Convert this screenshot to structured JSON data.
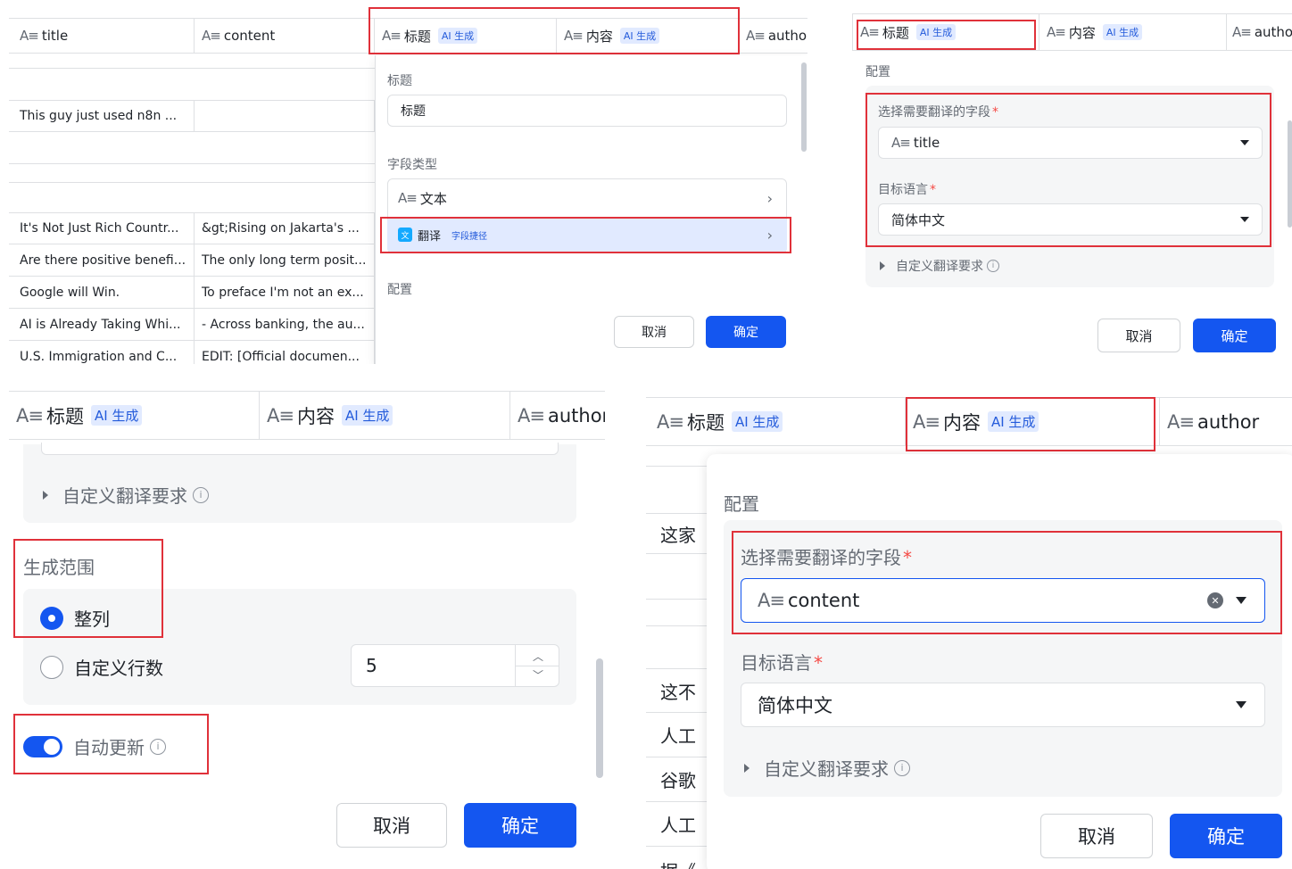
{
  "columns": {
    "title": "title",
    "content": "content",
    "title_zh": "标题",
    "content_zh": "内容",
    "author": "author",
    "author_cut": "autho",
    "ai_badge": "AI 生成"
  },
  "p1": {
    "rows": [
      {
        "title": "",
        "content": ""
      },
      {
        "title": "This guy just used n8n ...",
        "content": ""
      },
      {
        "title": "",
        "content": ""
      },
      {
        "title": "",
        "content": ""
      },
      {
        "title": "It's Not Just Rich Countr...",
        "content": "&gt;Rising on Jakarta's ..."
      },
      {
        "title": "Are there positive benefi...",
        "content": "The only long term posit..."
      },
      {
        "title": "Google will Win.",
        "content": "To preface I'm not an ex..."
      },
      {
        "title": "AI is Already Taking Whi...",
        "content": "- Across banking, the au..."
      },
      {
        "title": "U.S. Immigration and C...",
        "content": "EDIT: [Official documen..."
      }
    ],
    "dialog": {
      "title_label": "标题",
      "title_value": "标题",
      "field_type_label": "字段类型",
      "type_text": "文本",
      "type_translate": "翻译",
      "shortcut_badge": "字段捷径",
      "config_label": "配置",
      "cancel": "取消",
      "ok": "确定"
    }
  },
  "p2": {
    "config_label": "配置",
    "field_label": "选择需要翻译的字段",
    "field_value": "title",
    "lang_label": "目标语言",
    "lang_value": "简体中文",
    "custom_req": "自定义翻译要求",
    "info": "i",
    "cancel": "取消",
    "ok": "确定"
  },
  "p3": {
    "custom_req": "自定义翻译要求",
    "range_label": "生成范围",
    "opt_whole": "整列",
    "opt_custom": "自定义行数",
    "rows_value": "5",
    "auto_update": "自动更新",
    "info": "i",
    "cancel": "取消",
    "ok": "确定"
  },
  "p4": {
    "rows": [
      "这家",
      "这不",
      "人工",
      "谷歌",
      "人工",
      "据《"
    ],
    "config_label": "配置",
    "field_label": "选择需要翻译的字段",
    "field_value": "content",
    "lang_label": "目标语言",
    "lang_value": "简体中文",
    "custom_req": "自定义翻译要求",
    "info": "i",
    "clear": "✕",
    "cancel": "取消",
    "ok": "确定"
  }
}
